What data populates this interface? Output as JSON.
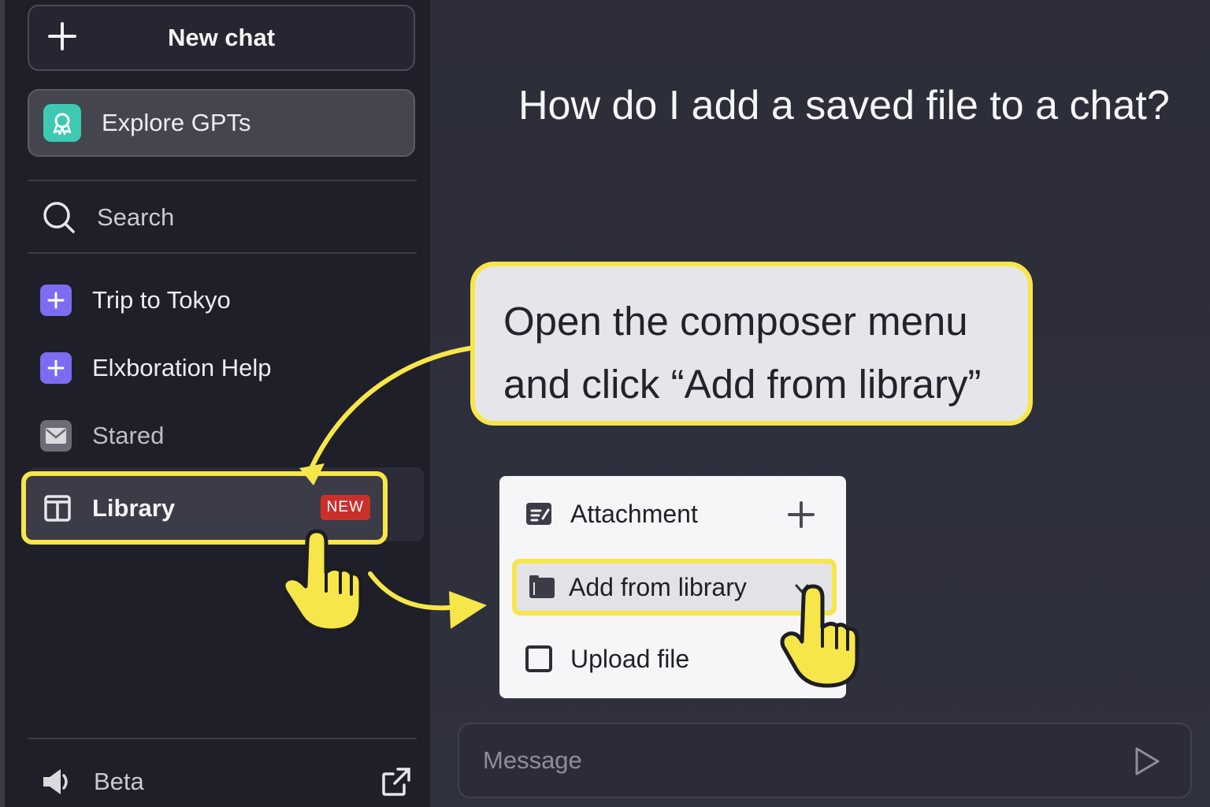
{
  "sidebar": {
    "new_chat_label": "New chat",
    "explore_label": "Explore GPTs",
    "search_label": "Search",
    "items": [
      {
        "label": "Trip to Tokyo",
        "icon": "plus-square-icon"
      },
      {
        "label": "Elxboration Help",
        "icon": "plus-square-icon"
      },
      {
        "label": "Stared",
        "icon": "mail-icon"
      }
    ],
    "library_label": "Library",
    "library_badge": "NEW",
    "footer_label": "Beta"
  },
  "main": {
    "question": "How do I add a saved file to a chat?",
    "callout_line1": "Open the composer menu",
    "callout_line2": "and click “Add from library”",
    "menu": {
      "attachment_label": "Attachment",
      "add_library_label": "Add from library",
      "upload_label": "Upload file"
    },
    "composer_placeholder": "Message"
  },
  "colors": {
    "highlight": "#f7e64a",
    "badge": "#c9302c",
    "explore_icon": "#3ec9b3",
    "item_icon": "#7c6cf2"
  }
}
